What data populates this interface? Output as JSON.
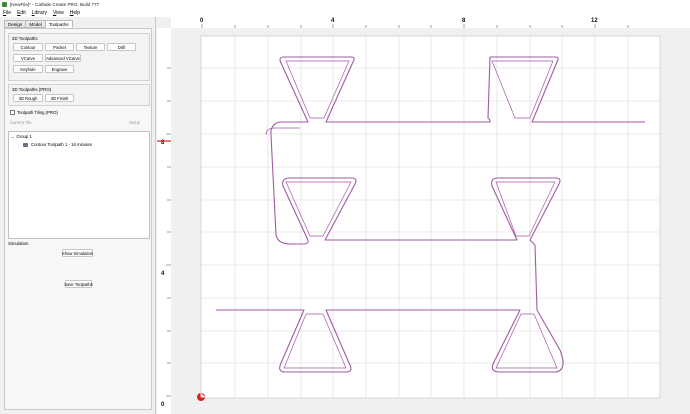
{
  "window": {
    "title": "[NewFile]* - Carbide Create PRO, Build 777"
  },
  "menu": [
    "File",
    "Edit",
    "Library",
    "View",
    "Help"
  ],
  "tabs": [
    "Design",
    "Model",
    "Toolpaths"
  ],
  "toolpaths_2d": {
    "title": "2D Toolpaths",
    "buttons": [
      "Contour",
      "Pocket",
      "Texture",
      "Drill",
      "VCarve",
      "Advanced VCarve",
      "Keyhole",
      "Engrave"
    ]
  },
  "toolpaths_3d": {
    "title": "3D Toolpaths (PRO)",
    "buttons": [
      "3D Rough",
      "3D Finish"
    ]
  },
  "tiling": {
    "label": "Toolpath Tiling (PRO)",
    "current_tile": "Current Tile",
    "setup": "Setup"
  },
  "tree": {
    "group": "Group 1",
    "item": "Contour Toolpath 1 - 16 minutes"
  },
  "simulation": {
    "label": "Simulation",
    "show_button": "Show Simulation",
    "save_button": "Save Toolpaths"
  },
  "ruler": {
    "x_labels": [
      "0",
      "4",
      "8",
      "12"
    ],
    "y_labels": [
      "8",
      "4",
      "0"
    ]
  },
  "colors": {
    "toolpath": "#a05aa5",
    "origin": "#e02020",
    "grid": "#d8d8d8"
  }
}
